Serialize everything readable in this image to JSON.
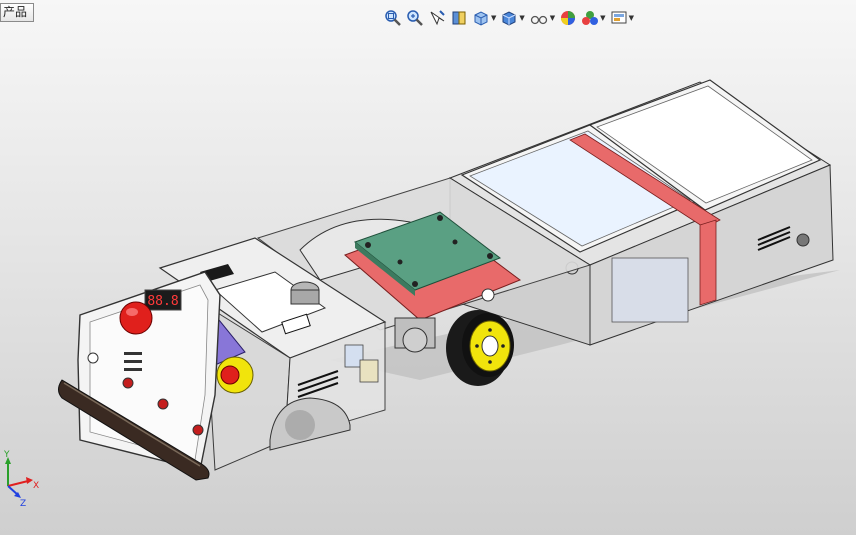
{
  "tabs": {
    "product_tab_label": "产品"
  },
  "toolbar": {
    "buttons": [
      {
        "icon": "zoom-to-fit-icon"
      },
      {
        "icon": "zoom-to-area-icon"
      },
      {
        "icon": "previous-view-icon"
      },
      {
        "icon": "section-view-icon"
      },
      {
        "icon": "view-orientation-icon",
        "dropdown": true
      },
      {
        "icon": "display-style-icon",
        "dropdown": true
      },
      {
        "icon": "hide-show-items-icon",
        "dropdown": true
      },
      {
        "icon": "edit-appearance-icon"
      },
      {
        "icon": "apply-scene-icon",
        "dropdown": true
      },
      {
        "icon": "view-settings-icon",
        "dropdown": true
      }
    ]
  },
  "triad": {
    "x_label": "X",
    "y_label": "Y",
    "z_label": "Z",
    "x_color": "#e02020",
    "y_color": "#2aa02a",
    "z_color": "#2040e0"
  },
  "model": {
    "readout": "88.8",
    "body_fill": "#dcdcdc",
    "frame_color": "#e86a6a",
    "plate_color": "#5aa083",
    "wheel_color": "#f1e40c",
    "panel_color": "#8876d8",
    "estop_color": "#e0201c"
  }
}
